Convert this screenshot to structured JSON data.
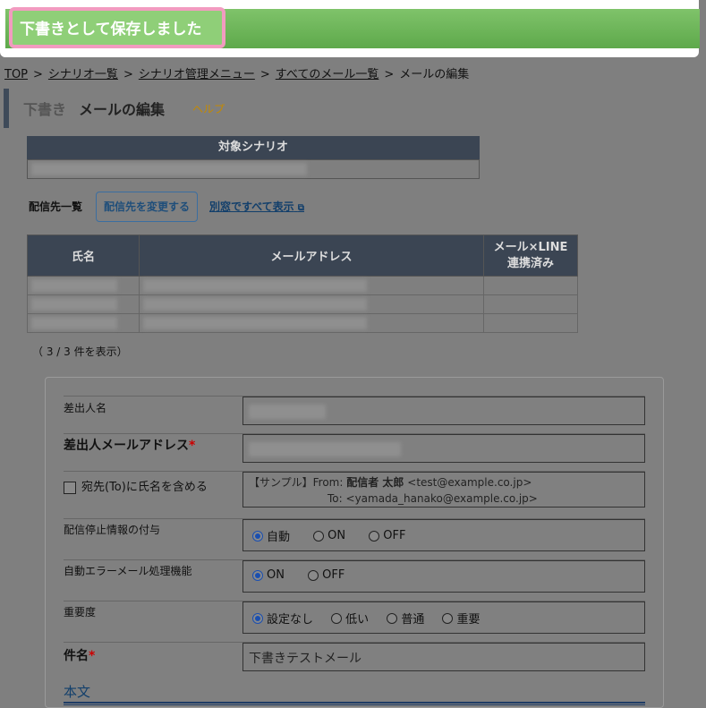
{
  "notice": {
    "text": "下書きとして保存しました"
  },
  "breadcrumb": {
    "items": [
      "TOP",
      "シナリオ一覧",
      "シナリオ管理メニュー",
      "すべてのメール一覧"
    ],
    "current": "メールの編集",
    "separator": ">"
  },
  "title": {
    "draft": "下書き",
    "main": "メールの編集",
    "help": "ヘルプ"
  },
  "scenario": {
    "header": "対象シナリオ"
  },
  "recipients": {
    "label": "配信先一覧",
    "change_button": "配信先を変更する",
    "window_link": "別窓ですべて表示",
    "columns": [
      "氏名",
      "メールアドレス",
      "メール×LINE",
      "連携済み"
    ],
    "count_text": "（ 3 / 3 件を表示）"
  },
  "form": {
    "sender_name_label": "差出人名",
    "sender_email_label": "差出人メールアドレス",
    "required_mark": "*",
    "include_name_label": "宛先(To)に氏名を含める",
    "sample_prefix": "【サンプル】From:",
    "sample_from_name": "配信者 太郎",
    "sample_from_addr": "<test@example.co.jp>",
    "sample_to_label": "To:",
    "sample_to_addr": "<yamada_hanako@example.co.jp>",
    "unsub_label": "配信停止情報の付与",
    "unsub_options": [
      "自動",
      "ON",
      "OFF"
    ],
    "error_label": "自動エラーメール処理機能",
    "error_options": [
      "ON",
      "OFF"
    ],
    "priority_label": "重要度",
    "priority_options": [
      "設定なし",
      "低い",
      "普通",
      "重要"
    ],
    "subject_label": "件名",
    "subject_value": "下書きテストメール",
    "body_label": "本文"
  }
}
